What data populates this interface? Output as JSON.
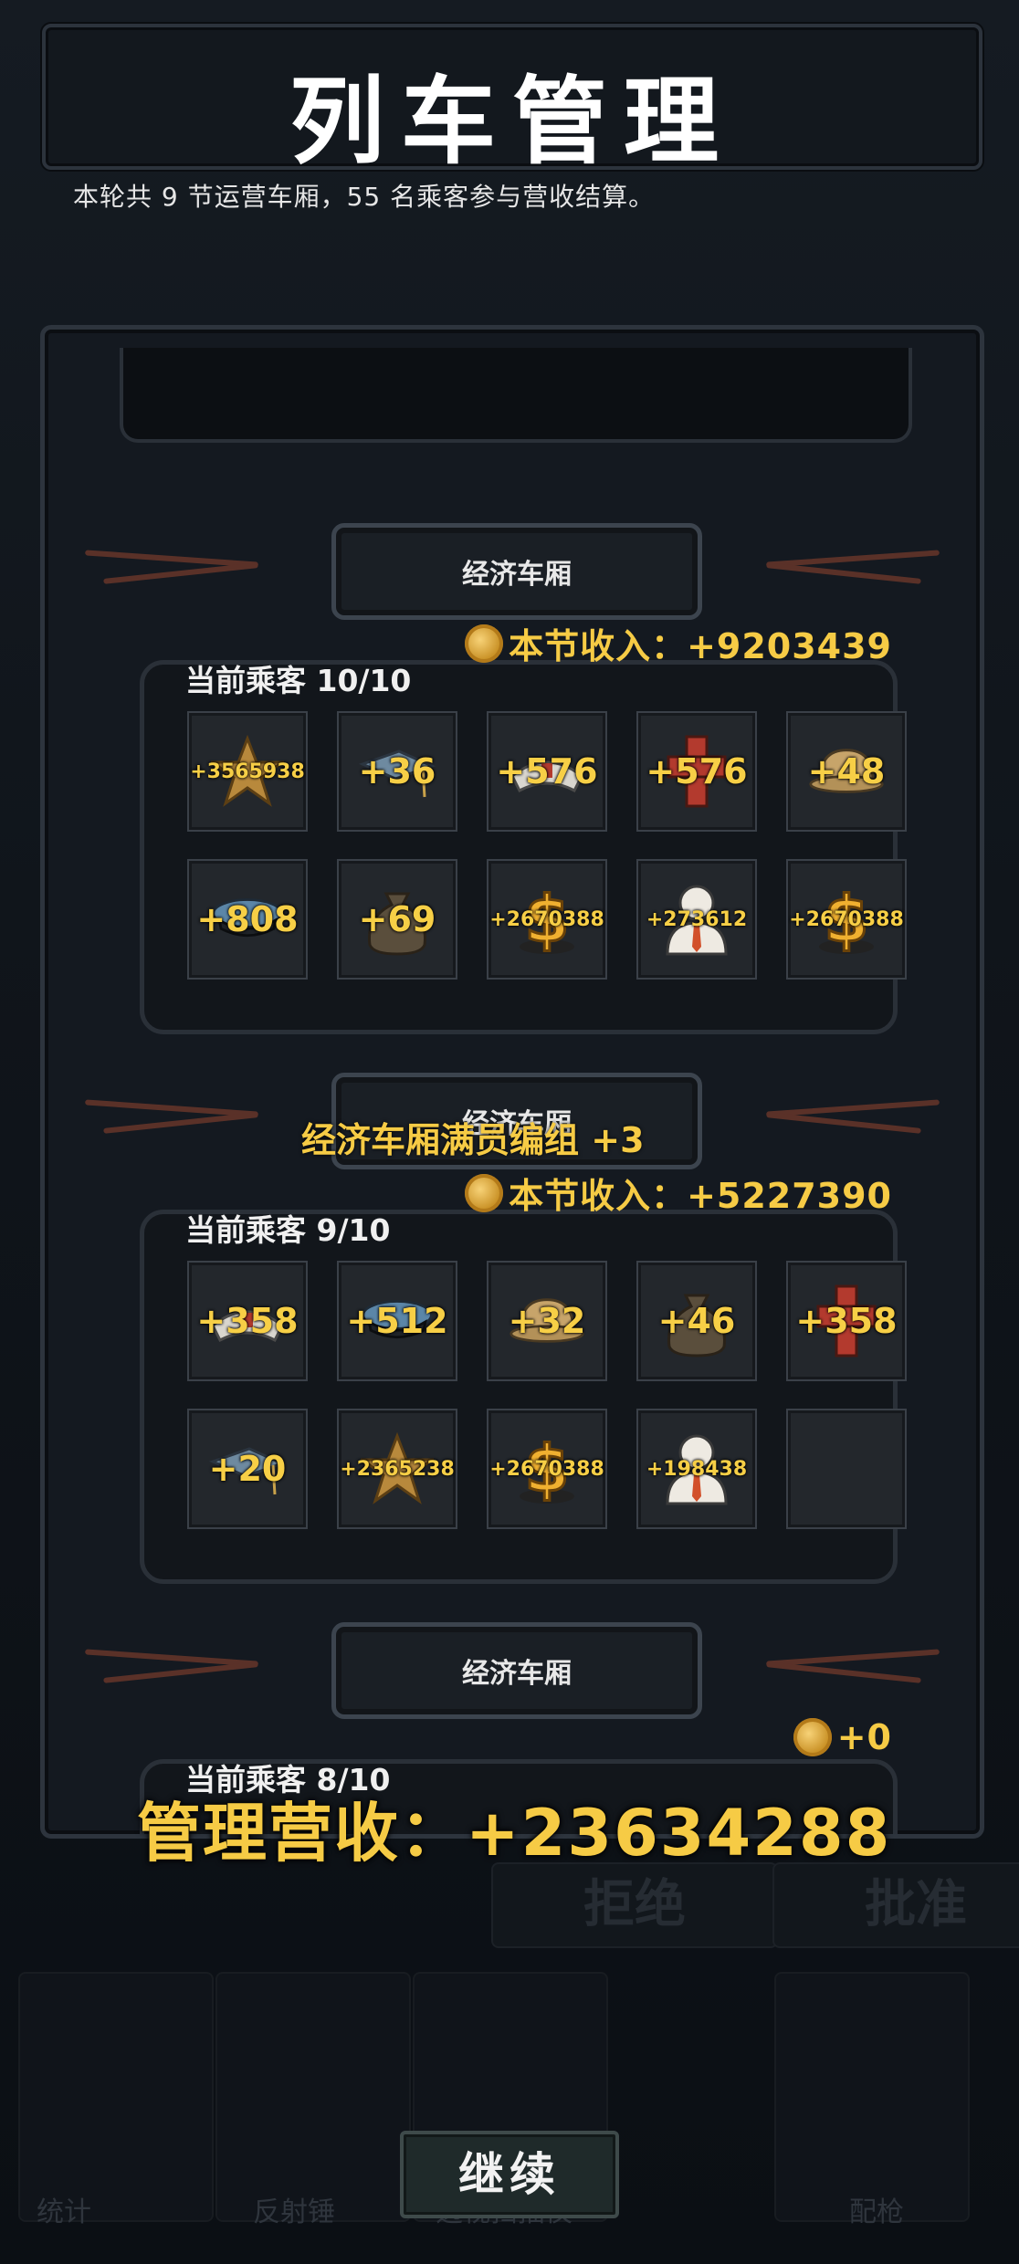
{
  "title": "列车管理",
  "subtitle": "本轮共 9 节运营车厢，55 名乘客参与营收结算。",
  "cars": [
    {
      "name": "经济车厢",
      "income_label": "本节收入：+9203439",
      "passengers_label": "当前乘客 10/10",
      "slots": [
        {
          "icon": "sheriff-star-icon",
          "value": "+3565938",
          "size": "small"
        },
        {
          "icon": "graduation-cap-icon",
          "value": "+36",
          "size": "big"
        },
        {
          "icon": "nurse-cap-icon",
          "value": "+576",
          "size": "big"
        },
        {
          "icon": "medical-cross-icon",
          "value": "+576",
          "size": "big"
        },
        {
          "icon": "pith-helmet-icon",
          "value": "+48",
          "size": "big"
        },
        {
          "icon": "police-cap-icon",
          "value": "+808",
          "size": "big"
        },
        {
          "icon": "money-bag-icon",
          "value": "+69",
          "size": "big"
        },
        {
          "icon": "dollar-sign-icon",
          "value": "+2670388",
          "size": "small"
        },
        {
          "icon": "businessman-icon",
          "value": "+273612",
          "size": "small"
        },
        {
          "icon": "dollar-sign-icon",
          "value": "+2670388",
          "size": "small"
        }
      ]
    },
    {
      "name": "经济车厢",
      "income_label": "本节收入：+5227390",
      "passengers_label": "当前乘客 9/10",
      "slots": [
        {
          "icon": "nurse-cap-icon",
          "value": "+358",
          "size": "big"
        },
        {
          "icon": "police-cap-icon",
          "value": "+512",
          "size": "big"
        },
        {
          "icon": "pith-helmet-icon",
          "value": "+32",
          "size": "big"
        },
        {
          "icon": "money-bag-icon",
          "value": "+46",
          "size": "big"
        },
        {
          "icon": "medical-cross-icon",
          "value": "+358",
          "size": "big"
        },
        {
          "icon": "graduation-cap-icon",
          "value": "+20",
          "size": "big"
        },
        {
          "icon": "sheriff-star-icon",
          "value": "+2365238",
          "size": "small"
        },
        {
          "icon": "dollar-sign-icon",
          "value": "+2670388",
          "size": "small"
        },
        {
          "icon": "businessman-icon",
          "value": "+198438",
          "size": "small"
        },
        {
          "icon": "empty-slot",
          "value": "",
          "size": "big"
        }
      ]
    },
    {
      "name": "经济车厢",
      "income_label": "+0",
      "passengers_label": "当前乘客 8/10",
      "slots": []
    }
  ],
  "bonus_banner": "经济车厢满员编组  +3",
  "total_label": "管理营收：+23634288",
  "background_buttons": {
    "reject": "拒绝",
    "approve": "批准"
  },
  "background_tools": [
    "统计",
    "反射锤",
    "透视扫描仪",
    "配枪"
  ],
  "continue_label": "继续",
  "colors": {
    "gold": "#f6cb45",
    "frame": "#2d343d",
    "slot_bg": "#23272c",
    "horn": "#5a3128"
  }
}
